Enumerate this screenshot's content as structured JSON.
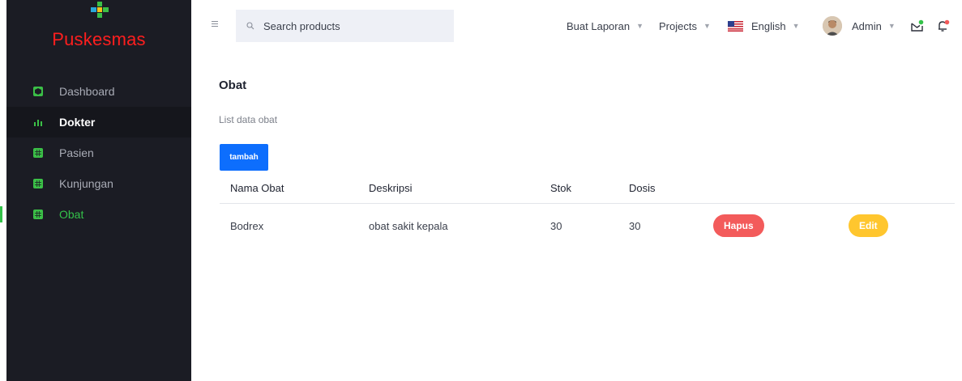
{
  "sidebar": {
    "brand": "Puskesmas",
    "items": [
      {
        "label": "Dashboard"
      },
      {
        "label": "Dokter"
      },
      {
        "label": "Pasien"
      },
      {
        "label": "Kunjungan"
      },
      {
        "label": "Obat"
      }
    ]
  },
  "header": {
    "search_placeholder": "Search products",
    "report_label": "Buat Laporan",
    "projects_label": "Projects",
    "language_label": "English",
    "user_label": "Admin"
  },
  "main": {
    "title": "Obat",
    "subtitle": "List data obat",
    "add_label": "tambah",
    "columns": [
      "Nama Obat",
      "Deskripsi",
      "Stok",
      "Dosis"
    ],
    "rows": [
      {
        "nama": "Bodrex",
        "deskripsi": "obat sakit kepala",
        "stok": "30",
        "dosis": "30",
        "delete_label": "Hapus",
        "edit_label": "Edit"
      }
    ]
  },
  "colors": {
    "sidebar_bg": "#1b1c24",
    "brand": "#ff1e1e",
    "active": "#34c24a",
    "primary": "#0d6efd",
    "danger": "#f35b5b",
    "warning": "#ffc62e"
  }
}
